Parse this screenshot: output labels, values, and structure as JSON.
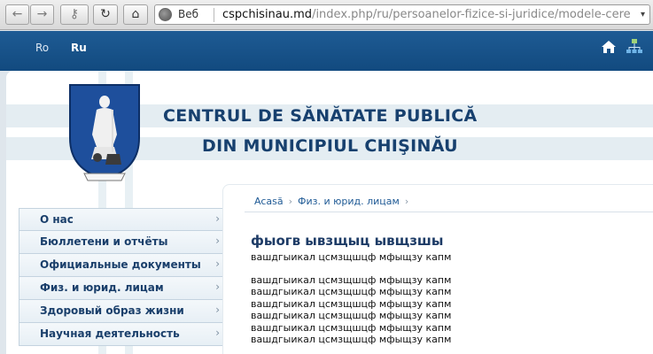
{
  "browser": {
    "url_prefix": "Веб",
    "url_domain": "cspchisinau.md",
    "url_path": "/index.php/ru/persoanelor-fizice-si-juridice/modele-cereri"
  },
  "icons": {
    "back": "←",
    "forward": "→",
    "key": "⚷",
    "reload": "↻",
    "home": "⌂",
    "dropdown": "▾"
  },
  "topnav": {
    "lang_ro": "Ro",
    "lang_ru": "Ru"
  },
  "header": {
    "title_line1": "CENTRUL DE  SĂNĂTATE PUBLICĂ",
    "title_line2": "DIN MUNICIPIUL CHIŞINĂU"
  },
  "menu": {
    "items": [
      {
        "label": "О нас"
      },
      {
        "label": "Бюллетени и отчёты"
      },
      {
        "label": "Официальные документы"
      },
      {
        "label": "Физ. и юрид. лицам"
      },
      {
        "label": "Здоровый образ жизни"
      },
      {
        "label": "Научная деятельность"
      }
    ],
    "arrow": "›"
  },
  "breadcrumb": {
    "home": "Acasă",
    "current": "Физ. и юрид. лицам",
    "sep": "›"
  },
  "content": {
    "heading": "фыогв ывзщыц ывщзшы",
    "lead": "вашдгыикал цсмзщшцф мфыщзу капм",
    "lines": [
      "вашдгыикал цсмзщшцф мфыщзу капм",
      "вашдгыикал цсмзщшцф мфыщзу капм",
      "вашдгыикал цсмзщшцф мфыщзу капм",
      "вашдгыикал цсмзщшцф мфыщзу капм",
      "вашдгыикал цсмзщшцф мфыщзу капм",
      "вашдгыикал цсмзщшцф мфыщзу капм"
    ]
  },
  "colors": {
    "brand_blue": "#124a7f",
    "title_blue": "#17406e",
    "band": "#e4edf2"
  }
}
